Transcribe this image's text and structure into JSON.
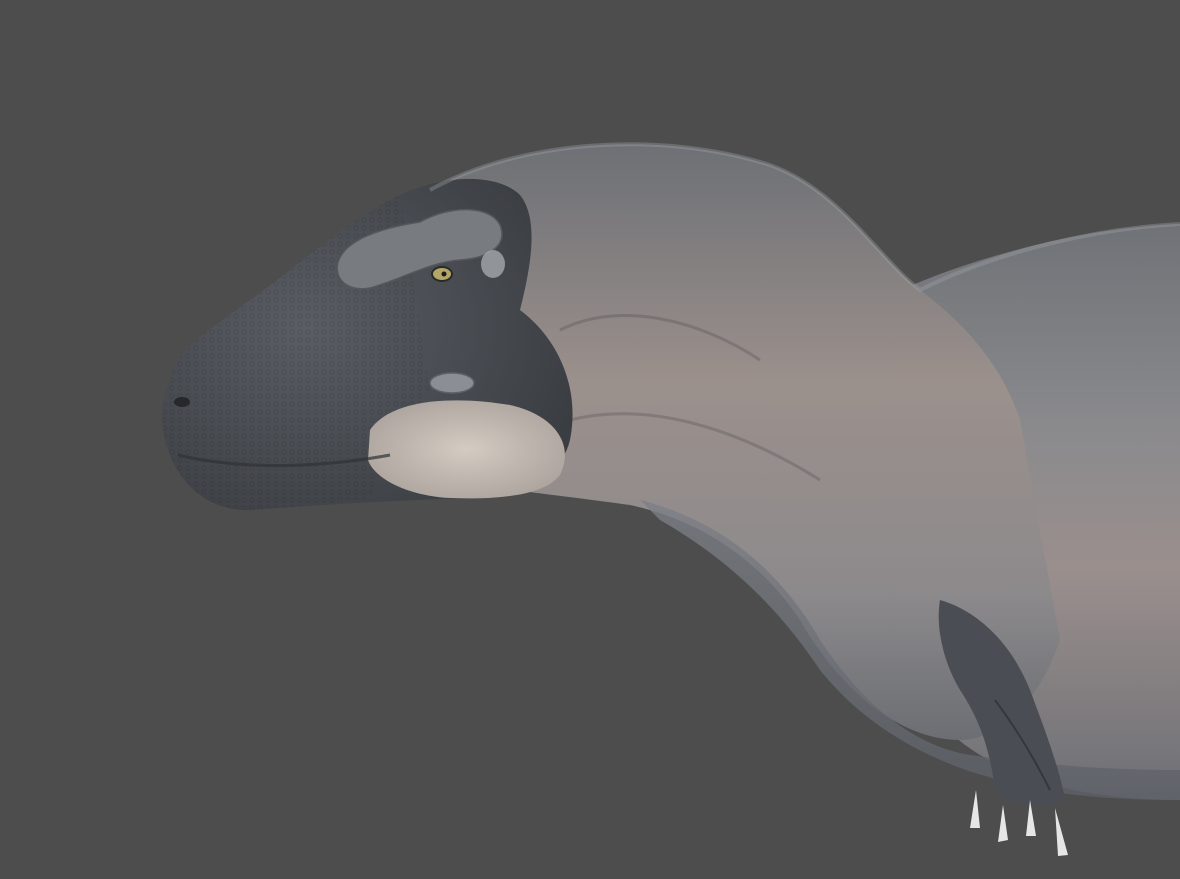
{
  "scene": {
    "subject": "dinosaur-3d-render",
    "background_color": "#4d4d4d",
    "colors": {
      "skin_grey": "#7e8185",
      "skin_dark": "#3c3f44",
      "skin_pale": "#c7c0b8",
      "skin_pinkish": "#a5968f",
      "eye": "#b3a768",
      "claw": "#e6e6e6"
    }
  }
}
